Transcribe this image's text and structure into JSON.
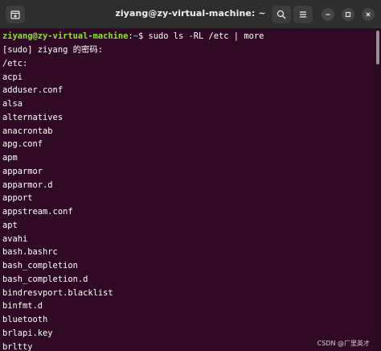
{
  "window": {
    "title": "ziyang@zy-virtual-machine: ~",
    "bg_color": "#300a24",
    "titlebar_color": "#2e2e2e"
  },
  "titlebar": {
    "left_icon": "new-tab-icon",
    "right_icons": [
      "search-icon",
      "hamburger-menu-icon",
      "minimize-icon",
      "maximize-icon",
      "close-icon"
    ]
  },
  "terminal": {
    "prompt": {
      "user_host": "ziyang@zy-virtual-machine",
      "sep": ":",
      "path": "~",
      "symbol": "$",
      "command": " sudo ls -RL /etc | more"
    },
    "lines": [
      "[sudo] ziyang 的密码:",
      "/etc:",
      "acpi",
      "adduser.conf",
      "alsa",
      "alternatives",
      "anacrontab",
      "apg.conf",
      "apm",
      "apparmor",
      "apparmor.d",
      "apport",
      "appstream.conf",
      "apt",
      "avahi",
      "bash.bashrc",
      "bash_completion",
      "bash_completion.d",
      "bindresvport.blacklist",
      "binfmt.d",
      "bluetooth",
      "brlapi.key",
      "brltty"
    ]
  },
  "watermark": "CSDN @厂里英才"
}
